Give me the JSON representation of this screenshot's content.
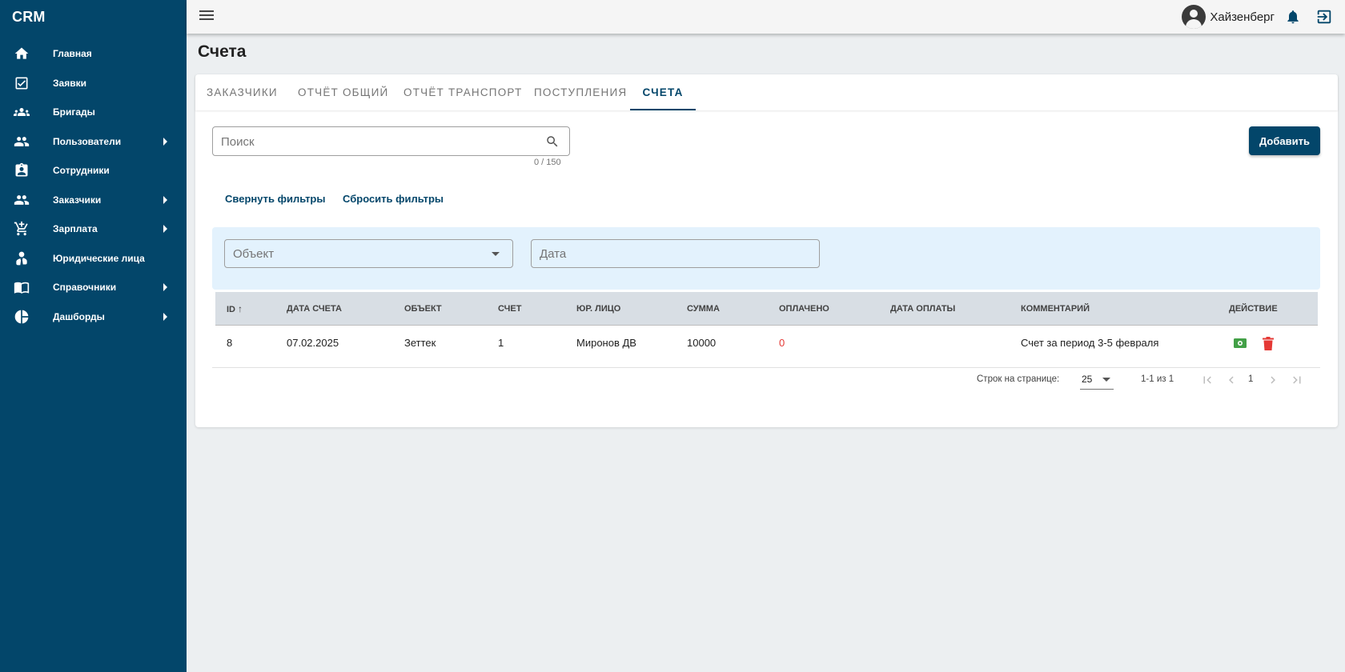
{
  "app": {
    "brand": "CRM"
  },
  "sidebar": {
    "items": [
      {
        "label": "Главная",
        "icon": "home-icon",
        "has_submenu": false
      },
      {
        "label": "Заявки",
        "icon": "checkbox-icon",
        "has_submenu": false
      },
      {
        "label": "Бригады",
        "icon": "group-icon",
        "has_submenu": false
      },
      {
        "label": "Пользователи",
        "icon": "people-icon",
        "has_submenu": true
      },
      {
        "label": "Сотрудники",
        "icon": "badge-icon",
        "has_submenu": false
      },
      {
        "label": "Заказчики",
        "icon": "people-icon",
        "has_submenu": true
      },
      {
        "label": "Зарплата",
        "icon": "cart-icon",
        "has_submenu": true
      },
      {
        "label": "Юридические лица",
        "icon": "person-tie-icon",
        "has_submenu": false
      },
      {
        "label": "Справочники",
        "icon": "book-icon",
        "has_submenu": true
      },
      {
        "label": "Дашборды",
        "icon": "pie-chart-icon",
        "has_submenu": true
      }
    ]
  },
  "topbar": {
    "username": "Хайзенберг"
  },
  "page": {
    "title": "Счета"
  },
  "tabs": [
    {
      "label": "Заказчики",
      "active": false
    },
    {
      "label": "Отчёт общий",
      "active": false
    },
    {
      "label": "Отчёт транспорт",
      "active": false
    },
    {
      "label": "Поступления",
      "active": false
    },
    {
      "label": "Счета",
      "active": true
    }
  ],
  "search": {
    "placeholder": "Поиск",
    "value": "",
    "counter": "0 / 150"
  },
  "actions": {
    "add_label": "Добавить",
    "collapse_filters": "Свернуть фильтры",
    "reset_filters": "Сбросить фильтры"
  },
  "filters": {
    "object_placeholder": "Объект",
    "date_placeholder": "Дата"
  },
  "table": {
    "headers": [
      "ID",
      "Дата счета",
      "Объект",
      "Счет",
      "Юр. лицо",
      "Сумма",
      "Оплачено",
      "Дата оплаты",
      "Комментарий",
      "Действие"
    ],
    "sort": {
      "column": "ID",
      "direction": "asc"
    },
    "rows": [
      {
        "id": "8",
        "date": "07.02.2025",
        "object": "Зеттек",
        "invoice": "1",
        "entity": "Миронов ДВ",
        "amount": "10000",
        "paid": "0",
        "pay_date": "",
        "comment": "Счет за период 3-5 февраля"
      }
    ]
  },
  "pagination": {
    "rows_per_page_label": "Строк на странице:",
    "rows_per_page": "25",
    "range": "1-1 из 1",
    "page": "1"
  },
  "colors": {
    "primary": "#03466a",
    "filter_bg": "#e3f2fd",
    "paid_zero": "#e53935",
    "pay_icon": "#43a047",
    "delete_icon": "#e53935"
  }
}
